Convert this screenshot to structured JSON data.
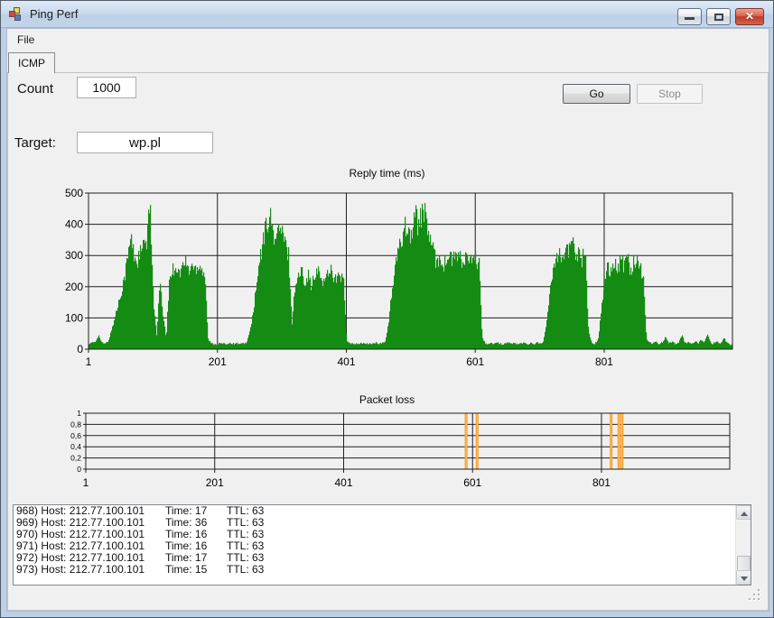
{
  "window": {
    "title": "Ping Perf"
  },
  "titlebar_icons": [
    "minimize",
    "maximize",
    "close"
  ],
  "menu": {
    "file": "File"
  },
  "tabs": [
    "ICMP"
  ],
  "form": {
    "count_label": "Count",
    "count_value": "1000",
    "target_label": "Target:",
    "target_value": "wp.pl"
  },
  "buttons": {
    "go": "Go",
    "stop": "Stop"
  },
  "chart_data": [
    {
      "type": "bar",
      "title": "Reply time (ms)",
      "xlabel": "",
      "ylabel": "",
      "xlim": [
        1,
        1000
      ],
      "ylim": [
        0,
        500
      ],
      "xticks": [
        1,
        201,
        401,
        601,
        801
      ],
      "yticks": [
        0,
        100,
        200,
        300,
        400,
        500
      ],
      "grid": true,
      "bar_color": "#148c14",
      "x_start": 1,
      "x_step": 5,
      "values": [
        18,
        20,
        24,
        45,
        20,
        17,
        25,
        60,
        100,
        140,
        185,
        230,
        290,
        360,
        300,
        280,
        310,
        330,
        340,
        475,
        160,
        40,
        210,
        110,
        35,
        230,
        255,
        270,
        240,
        265,
        280,
        250,
        270,
        255,
        275,
        260,
        240,
        30,
        18,
        16,
        17,
        19,
        16,
        18,
        20,
        17,
        19,
        16,
        18,
        22,
        60,
        120,
        200,
        280,
        340,
        400,
        430,
        380,
        350,
        390,
        370,
        330,
        300,
        80,
        210,
        230,
        250,
        220,
        240,
        205,
        225,
        250,
        230,
        210,
        245,
        260,
        235,
        220,
        240,
        215,
        25,
        18,
        16,
        19,
        17,
        20,
        16,
        18,
        17,
        21,
        16,
        19,
        24,
        90,
        180,
        260,
        310,
        350,
        410,
        380,
        360,
        440,
        400,
        430,
        440,
        390,
        350,
        300,
        280,
        295,
        270,
        285,
        300,
        280,
        310,
        290,
        270,
        295,
        285,
        275,
        290,
        280,
        40,
        18,
        16,
        19,
        17,
        20,
        16,
        18,
        22,
        17,
        19,
        16,
        18,
        20,
        17,
        19,
        16,
        21,
        18,
        25,
        80,
        180,
        260,
        300,
        320,
        290,
        330,
        310,
        360,
        300,
        320,
        290,
        310,
        60,
        20,
        18,
        30,
        120,
        230,
        270,
        250,
        280,
        260,
        290,
        270,
        300,
        255,
        275,
        290,
        260,
        240,
        35,
        20,
        18,
        25,
        17,
        22,
        40,
        18,
        24,
        16,
        20,
        45,
        18,
        22,
        17,
        25,
        19,
        30,
        22,
        48,
        17,
        20,
        25,
        18,
        35,
        22,
        16
      ]
    },
    {
      "type": "bar",
      "title": "Packet loss",
      "xlabel": "",
      "ylabel": "",
      "xlim": [
        1,
        1000
      ],
      "ylim": [
        0,
        1
      ],
      "xticks": [
        1,
        201,
        401,
        601,
        801
      ],
      "ytick_labels": [
        "1",
        "0,8",
        "0,6",
        "0,4",
        "0,2",
        "0"
      ],
      "grid": true,
      "bar_color": "#f59a23",
      "loss_x": [
        591,
        608,
        816,
        828,
        833
      ],
      "loss_value": 1
    }
  ],
  "log": {
    "items": [
      {
        "c1": "968) Host: 212.77.100.101",
        "c2": "Time: 17",
        "c3": "TTL: 63"
      },
      {
        "c1": "969) Host: 212.77.100.101",
        "c2": "Time: 36",
        "c3": "TTL: 63"
      },
      {
        "c1": "970) Host: 212.77.100.101",
        "c2": "Time: 16",
        "c3": "TTL: 63"
      },
      {
        "c1": "971) Host: 212.77.100.101",
        "c2": "Time: 16",
        "c3": "TTL: 63"
      },
      {
        "c1": "972) Host: 212.77.100.101",
        "c2": "Time: 17",
        "c3": "TTL: 63"
      },
      {
        "c1": "973) Host: 212.77.100.101",
        "c2": "Time: 15",
        "c3": "TTL: 63"
      }
    ]
  },
  "colors": {
    "reply_bar": "#148c14",
    "loss_bar": "#f59a23",
    "grid_line": "#1f1f1f",
    "client_bg": "#f0f0f0"
  }
}
